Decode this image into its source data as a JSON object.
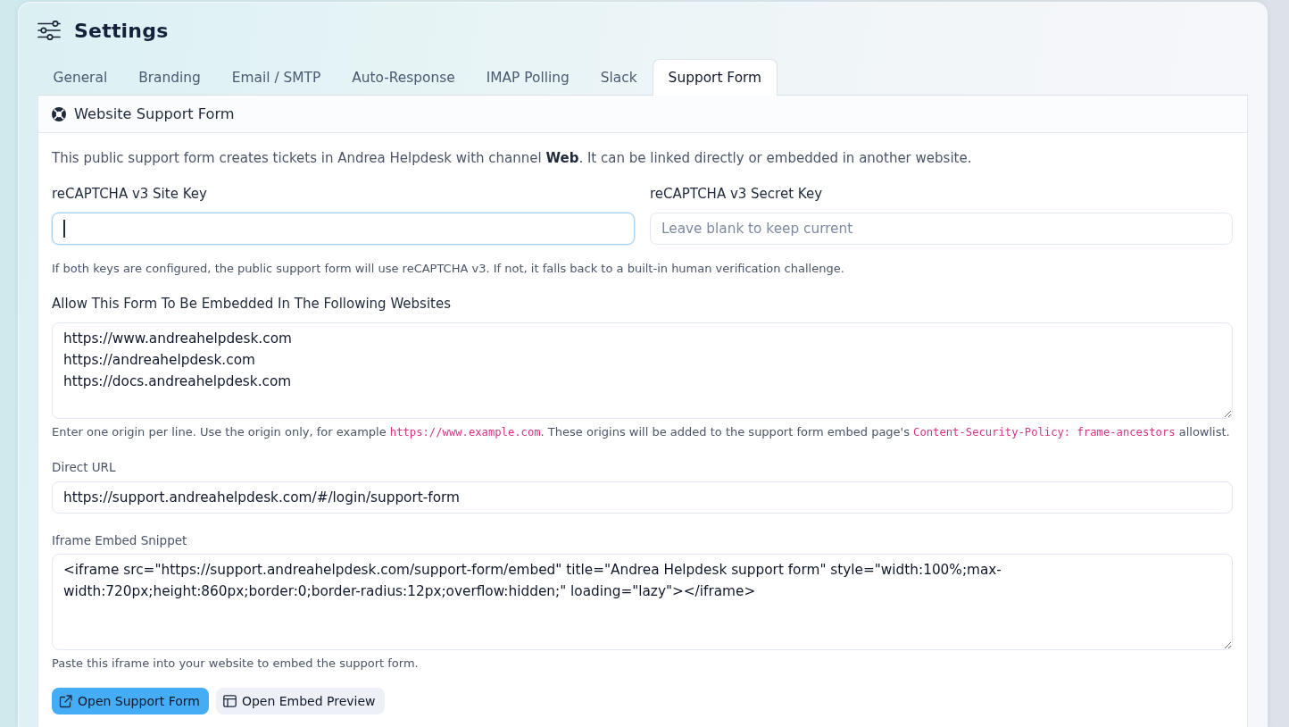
{
  "header": {
    "title": "Settings"
  },
  "tabs": [
    {
      "label": "General",
      "selected": false
    },
    {
      "label": "Branding",
      "selected": false
    },
    {
      "label": "Email / SMTP",
      "selected": false
    },
    {
      "label": "Auto-Response",
      "selected": false
    },
    {
      "label": "IMAP Polling",
      "selected": false
    },
    {
      "label": "Slack",
      "selected": false
    },
    {
      "label": "Support Form",
      "selected": true
    }
  ],
  "panel": {
    "title": "Website Support Form",
    "description": "This public support form creates tickets in Andrea Helpdesk with channel **Web**. It can be linked directly or embedded in another website.",
    "key_fields": [
      {
        "label": "reCAPTCHA v3 Site Key",
        "focused": true
      },
      {
        "label": "reCAPTCHA v3 Secret Key",
        "placeholder": "Leave blank to keep current",
        "focused": false
      }
    ],
    "key_hint": "If both keys are configured, the public support form will use reCAPTCHA v3. If not, it falls back to a built-in human verification challenge.",
    "origins": {
      "label": "Allow This Form To Be Embedded In The Following Websites",
      "value": "https://www.andreahelpdesk.com\nhttps://andreahelpdesk.com\nhttps://docs.andreahelpdesk.com",
      "hint": [
        {
          "kind": "text",
          "text": "Enter one origin per line. Use the origin only, for example "
        },
        {
          "kind": "code",
          "text": "https://www.example.com"
        },
        {
          "kind": "text",
          "text": ". These origins will be added to the support form embed page's "
        },
        {
          "kind": "code",
          "text": "Content-Security-Policy: frame-ancestors"
        },
        {
          "kind": "text",
          "text": " allowlist."
        }
      ]
    },
    "direct_url": {
      "label": "Direct URL",
      "value": "https://support.andreahelpdesk.com/#/login/support-form"
    },
    "embed_snippet": {
      "label": "Iframe Embed Snippet",
      "value": "<iframe src=\"https://support.andreahelpdesk.com/support-form/embed\" title=\"Andrea Helpdesk support form\" style=\"width:100%;max-width:720px;height:860px;border:0;border-radius:12px;overflow:hidden;\" loading=\"lazy\"></iframe>",
      "hint": "Paste this iframe into your website to embed the support form."
    },
    "buttons": [
      {
        "label": "Open Support Form",
        "kind": "primary"
      },
      {
        "label": "Open Embed Preview",
        "kind": "secondary"
      }
    ]
  }
}
